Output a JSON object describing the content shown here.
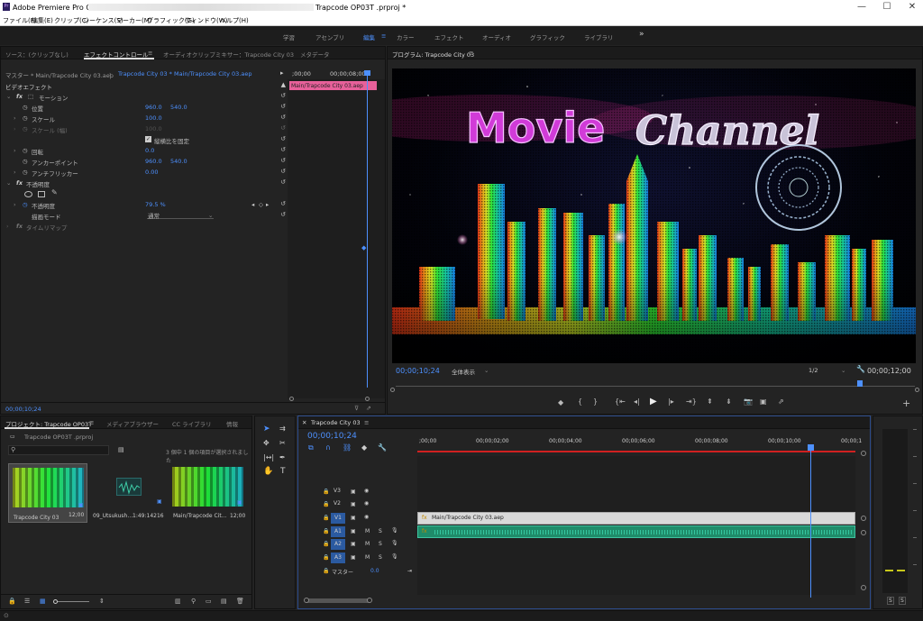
{
  "window": {
    "app_title": "Adobe Premiere Pro CC 2018",
    "project_file": "Trapcode OP03T .prproj *",
    "controls": [
      "—",
      "☐",
      "✕"
    ]
  },
  "menu": [
    "ファイル(F)",
    "編集(E)",
    "クリップ(C)",
    "シーケンス(S)",
    "マーカー(M)",
    "グラフィック(G)",
    "ウィンドウ(W)",
    "ヘルプ(H)"
  ],
  "workspaces": [
    "学習",
    "アセンブリ",
    "編集",
    "カラー",
    "エフェクト",
    "オーディオ",
    "グラフィック",
    "ライブラリ",
    "»"
  ],
  "effect_panel": {
    "tabs": [
      "ソース：(クリップなし)",
      "エフェクトコントロール",
      "オーディオクリップミキサー：Trapcode City 03",
      "メタデータ"
    ],
    "master": "マスター * Main/Trapcode City 03.aep",
    "clip_path": "Trapcode City 03 * Main/Trapcode City 03.aep",
    "timecode_start": ";00;00",
    "timecode_end": "00;00;08;00",
    "clip_bar": "Main/Trapcode City 03.aep",
    "video_effects": "ビデオエフェクト",
    "motion": "モーション",
    "position_label": "位置",
    "position_x": "960.0",
    "position_y": "540.0",
    "scale_label": "スケール",
    "scale_value": "100.0",
    "scale_width_label": "スケール (幅)",
    "scale_width_value": "100.0",
    "uniform_scale": "縦横比を固定",
    "rotation_label": "回転",
    "rotation_value": "0.0",
    "anchor_label": "アンカーポイント",
    "anchor_x": "960.0",
    "anchor_y": "540.0",
    "antiflicker_label": "アンチフリッカー",
    "antiflicker_value": "0.00",
    "opacity": "不透明度",
    "opacity_label": "不透明度",
    "opacity_value": "79.5 %",
    "blend_label": "描画モード",
    "blend_value": "通常",
    "time_remap": "タイムリマップ",
    "bottom_timecode": "00;00;10;24"
  },
  "program": {
    "title": "プログラム: Trapcode City 03",
    "timecode": "00;00;10;24",
    "fit": "全体表示",
    "quality": "1/2",
    "duration": "00;00;12;00",
    "logo_word1": "Movie",
    "logo_word2": "Channel"
  },
  "project_panel": {
    "tabs": [
      "プロジェクト: Trapcode OP03T",
      "メディアブラウザー",
      "CC ライブラリ",
      "情報"
    ],
    "project_file": "Trapcode OP03T .prproj",
    "selection_info": "3 個中 1 個の項目が選択されました",
    "items": [
      {
        "name": "Trapcode City 03",
        "duration": "12;00"
      },
      {
        "name": "09_Utsukush…",
        "duration": "1:49:14216"
      },
      {
        "name": "Main/Trapcode Cit…",
        "duration": "12;00"
      }
    ]
  },
  "timeline": {
    "title": "Trapcode City 03",
    "timecode": "00;00;10;24",
    "ruler": [
      ";00;00",
      "00;00;02;00",
      "00;00;04;00",
      "00;00;06;00",
      "00;00;08;00",
      "00;00;10;00",
      "00;00;1"
    ],
    "tracks": [
      "V3",
      "V2",
      "V1",
      "A1",
      "A2",
      "A3"
    ],
    "master_label": "マスター",
    "master_value": "0.0",
    "video_clip": "Main/Trapcode City 03.aep",
    "track_buttons": [
      "M",
      "S"
    ]
  },
  "audio_meter": {
    "labels": [
      "S",
      "S"
    ]
  }
}
